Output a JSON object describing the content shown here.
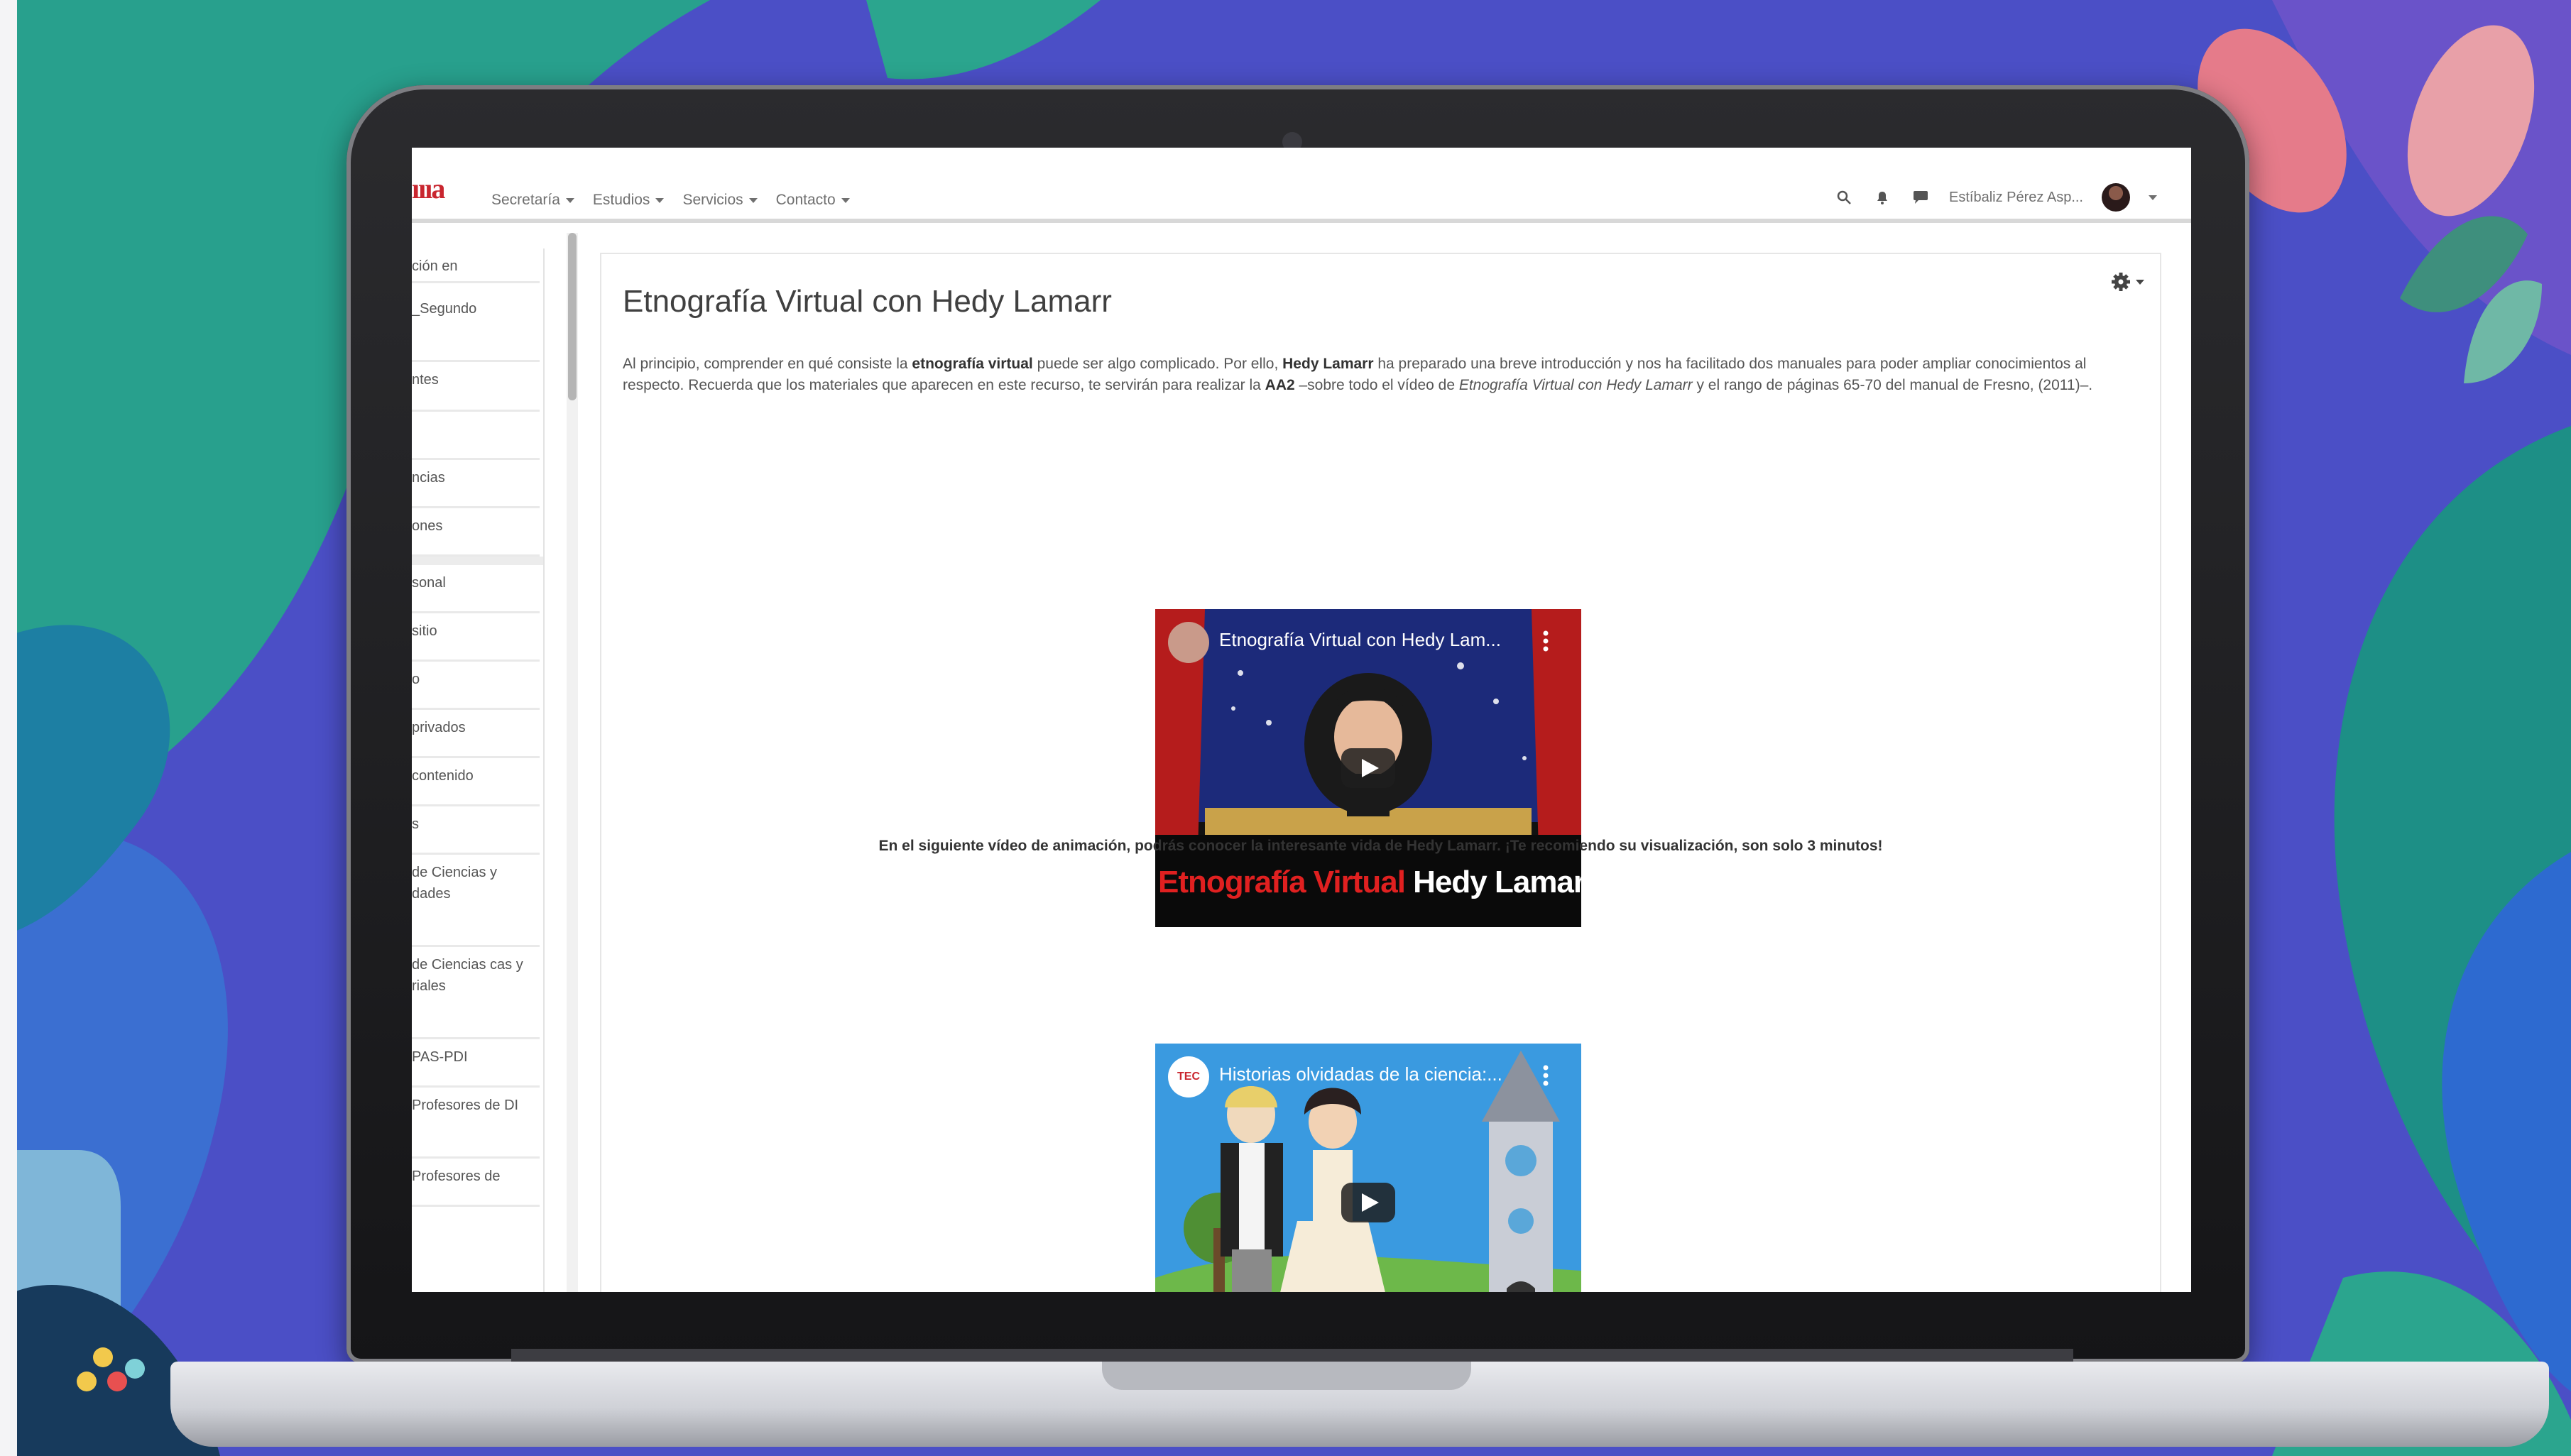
{
  "navbar": {
    "brand": "ıııa",
    "items": [
      {
        "label": "Secretaría"
      },
      {
        "label": "Estudios"
      },
      {
        "label": "Servicios"
      },
      {
        "label": "Contacto"
      }
    ],
    "user_name": "Estíbaliz Pérez Asp..."
  },
  "sidebar": {
    "items": [
      "ción en",
      "_Segundo",
      "ntes",
      "",
      "ncias",
      "ones",
      "sonal",
      " sitio",
      "o",
      " privados",
      " contenido",
      "s",
      " de Ciencias y dades",
      " de Ciencias cas y riales",
      " PAS-PDI",
      "Profesores de DI",
      "Profesores de"
    ]
  },
  "page": {
    "title": "Etnografía Virtual con Hedy Lamarr",
    "intro": {
      "p1": "Al principio, comprender en qué consiste la ",
      "b1": "etnografía virtual",
      "p2": " puede ser algo complicado. Por ello, ",
      "b2": "Hedy Lamarr",
      "p3": " ha preparado una breve introducción y nos ha facilitado dos manuales para poder ampliar conocimientos al respecto. Recuerda que los materiales que aparecen en este recurso, te servirán para realizar la ",
      "b3": "AA2",
      "p4": " –sobre todo el vídeo de ",
      "i1": "Etnografía Virtual con Hedy Lamarr",
      "p5": " y el rango de páginas 65-70 del manual de Fresno, (2011)–."
    },
    "video1": {
      "title": "Etnografía Virtual con Hedy Lam...",
      "caption_red": "Etnografía Virtual",
      "caption_white": " Hedy Lamar"
    },
    "middle_text": "En el siguiente vídeo de animación, podrás conocer la interesante vida de Hedy Lamarr. ¡Te recomiendo su visualización, son solo 3 minutos!",
    "video2": {
      "title": "Historias olvidadas de la ciencia:...",
      "channel": "TEC"
    }
  },
  "colors": {
    "brand_red": "#c9262f",
    "background_purple": "#4b4fc6",
    "background_teal": "#1f8c8f"
  }
}
